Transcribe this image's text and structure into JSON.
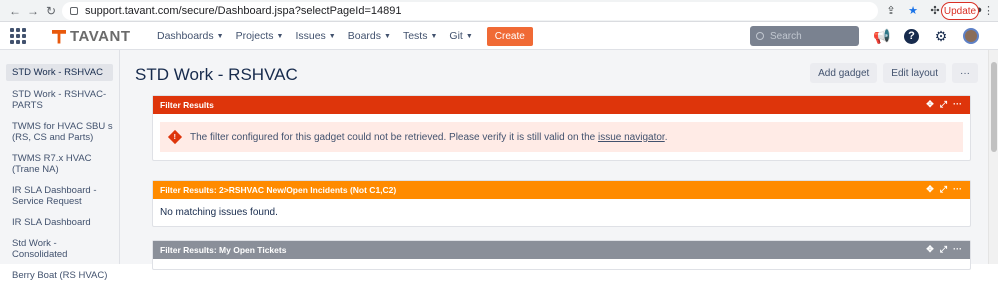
{
  "browser": {
    "url": "support.tavant.com/secure/Dashboard.jspa?selectPageId=14891",
    "update_label": "Update"
  },
  "topnav": {
    "logo_text": "TAVANT",
    "menu": [
      {
        "label": "Dashboards"
      },
      {
        "label": "Projects"
      },
      {
        "label": "Issues"
      },
      {
        "label": "Boards"
      },
      {
        "label": "Tests"
      },
      {
        "label": "Git"
      }
    ],
    "create_label": "Create",
    "search_placeholder": "Search"
  },
  "sidebar": {
    "items": [
      {
        "label": "STD Work - RSHVAC",
        "active": true
      },
      {
        "label": "STD Work - RSHVAC-PARTS"
      },
      {
        "label": "TWMS for HVAC SBU s (RS, CS and Parts)"
      },
      {
        "label": "TWMS R7.x HVAC (Trane NA)"
      },
      {
        "label": "IR SLA Dashboard - Service Request"
      },
      {
        "label": "IR SLA Dashboard"
      },
      {
        "label": "Std Work - Consolidated"
      },
      {
        "label": "Berry Boat (RS HVAC)"
      }
    ]
  },
  "main": {
    "title": "STD Work - RSHVAC",
    "add_gadget_label": "Add gadget",
    "edit_layout_label": "Edit layout",
    "more_label": "···",
    "gadgets": [
      {
        "title": "Filter Results",
        "color": "#de350b",
        "error_text": "The filter configured for this gadget could not be retrieved. Please verify it is still valid on the ",
        "error_link": "issue navigator",
        "error_end": "."
      },
      {
        "title": "Filter Results: 2>RSHVAC New/Open Incidents (Not C1,C2)",
        "color": "#ff8b00",
        "body": "No matching issues found."
      },
      {
        "title": "Filter Results: My Open Tickets",
        "color": "#8a8f99"
      }
    ]
  }
}
